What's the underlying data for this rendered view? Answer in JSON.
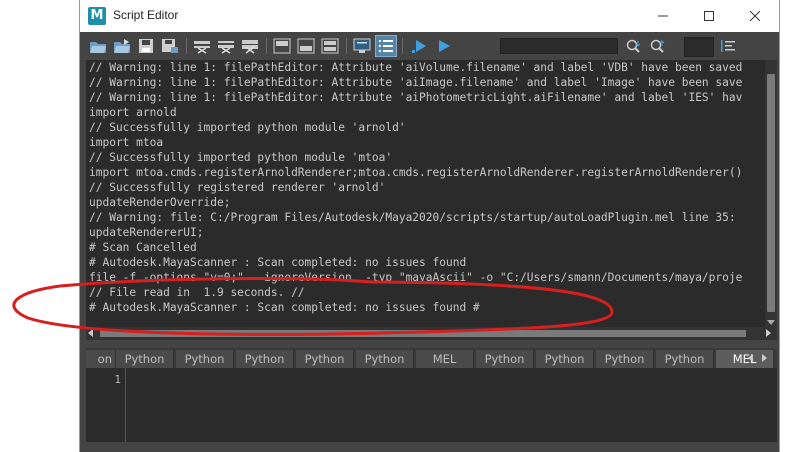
{
  "window": {
    "title": "Script Editor",
    "app_icon": "M"
  },
  "toolbar": {
    "buttons": [
      {
        "name": "open-script-icon"
      },
      {
        "name": "source-script-icon"
      },
      {
        "name": "save-script-icon"
      },
      {
        "name": "save-script-to-shelf-icon"
      },
      {
        "name": "clear-history-icon"
      },
      {
        "name": "clear-input-icon"
      },
      {
        "name": "clear-all-icon"
      },
      {
        "name": "show-history-icon"
      },
      {
        "name": "show-input-icon"
      },
      {
        "name": "show-both-icon"
      },
      {
        "name": "echo-all-commands-icon"
      },
      {
        "name": "show-line-numbers-icon"
      },
      {
        "name": "execute-all-icon"
      },
      {
        "name": "execute-icon"
      },
      {
        "name": "search-down-icon"
      },
      {
        "name": "search-up-icon"
      },
      {
        "name": "goto-line-icon"
      }
    ],
    "search_value": ""
  },
  "history": {
    "lines": [
      "// Warning: line 1: filePathEditor: Attribute 'aiVolume.filename' and label 'VDB' have been saved",
      "// Warning: line 1: filePathEditor: Attribute 'aiImage.filename' and label 'Image' have been save",
      "// Warning: line 1: filePathEditor: Attribute 'aiPhotometricLight.aiFilename' and label 'IES' hav",
      "import arnold",
      "// Successfully imported python module 'arnold'",
      "import mtoa",
      "// Successfully imported python module 'mtoa'",
      "import mtoa.cmds.registerArnoldRenderer;mtoa.cmds.registerArnoldRenderer.registerArnoldRenderer()",
      "// Successfully registered renderer 'arnold'",
      "updateRenderOverride;",
      "// Warning: file: C:/Program Files/Autodesk/Maya2020/scripts/startup/autoLoadPlugin.mel line 35:",
      "updateRendererUI;",
      "# Scan Cancelled",
      "# Autodesk.MayaScanner : Scan completed: no issues found",
      "file -f -options \"v=0;\"  -ignoreVersion  -typ \"mayaAscii\" -o \"C:/Users/smann/Documents/maya/proje",
      "// File read in  1.9 seconds. //",
      "# Autodesk.MayaScanner : Scan completed: no issues found #"
    ]
  },
  "tabs": [
    "on",
    "Python",
    "Python",
    "Python",
    "Python",
    "Python",
    "MEL",
    "Python",
    "Python",
    "Python",
    "Python",
    "MEL"
  ],
  "active_tab_index": 11,
  "editor": {
    "line_number": "1",
    "content": ""
  },
  "colors": {
    "accent": "#5285a6",
    "annotation": "#d61f1f"
  }
}
